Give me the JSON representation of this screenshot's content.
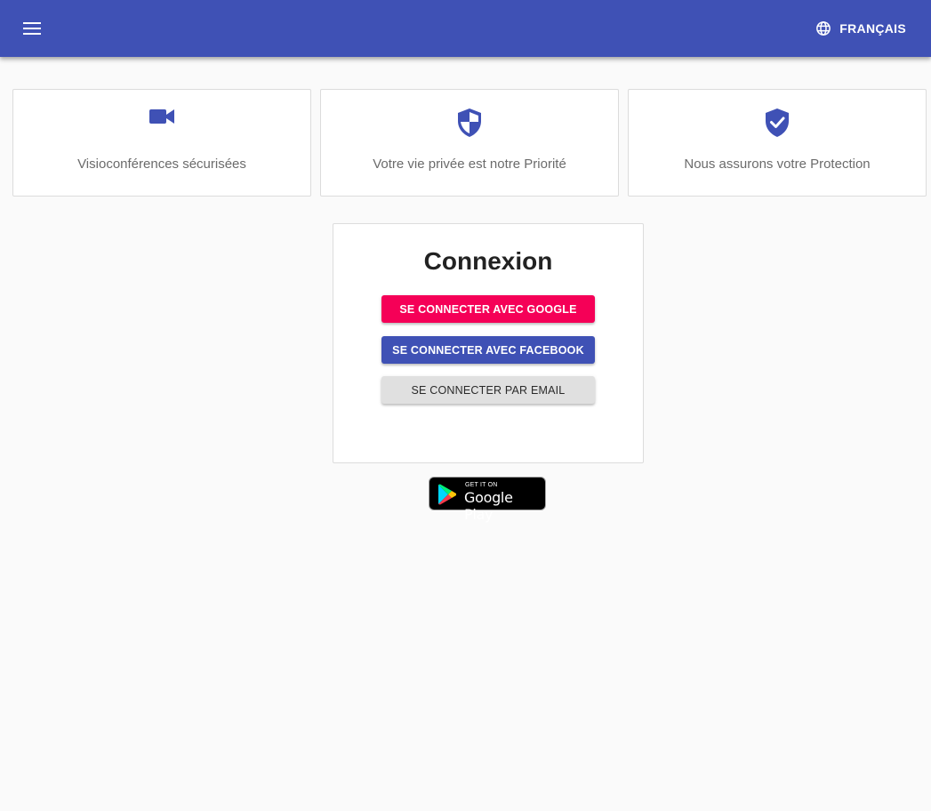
{
  "header": {
    "menu_icon": "hamburger-menu-icon",
    "language_icon": "globe-icon",
    "language_label": "FRANÇAIS",
    "background_color": "#3f51b5"
  },
  "features": [
    {
      "icon": "videocam-icon",
      "text": "Visioconférences sécurisées"
    },
    {
      "icon": "shield-icon",
      "text": "Votre vie privée est notre Priorité"
    },
    {
      "icon": "verified-shield-icon",
      "text": "Nous assurons votre Protection"
    }
  ],
  "login": {
    "title": "Connexion",
    "google_label": "SE CONNECTER AVEC GOOGLE",
    "facebook_label": "SE CONNECTER AVEC FACEBOOK",
    "email_label": "SE CONNECTER PAR EMAIL",
    "google_color": "#f50057",
    "facebook_color": "#3f51b5",
    "email_color": "#e0e0e0"
  },
  "play_badge": {
    "small_text": "GET IT ON",
    "big_text": "Google Play"
  },
  "accent_color": "#3f51b5"
}
